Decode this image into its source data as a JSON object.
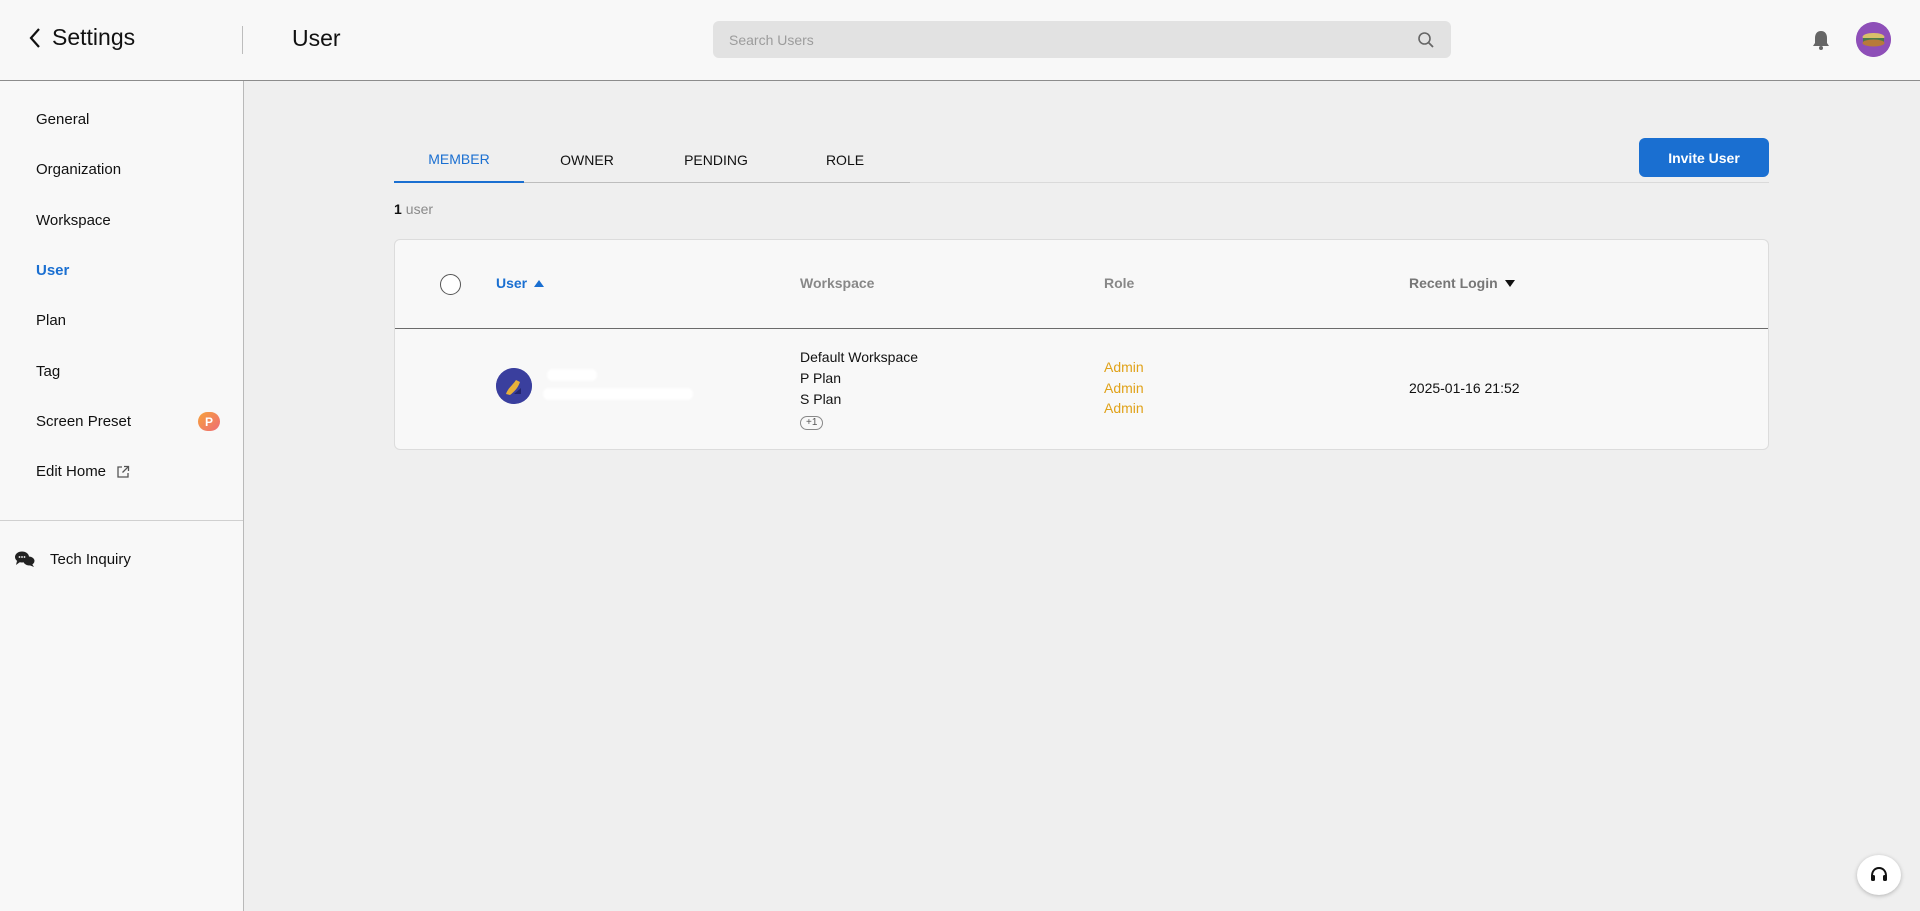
{
  "header": {
    "back_label": "Settings",
    "page_title": "User",
    "search_placeholder": "Search Users"
  },
  "sidebar": {
    "items": [
      {
        "label": "General"
      },
      {
        "label": "Organization"
      },
      {
        "label": "Workspace"
      },
      {
        "label": "User",
        "active": true
      },
      {
        "label": "Plan"
      },
      {
        "label": "Tag"
      },
      {
        "label": "Screen Preset",
        "badge": "P"
      },
      {
        "label": "Edit Home",
        "icon": "external-link-icon"
      }
    ],
    "tech_inquiry": "Tech Inquiry"
  },
  "tabs": [
    {
      "label": "MEMBER",
      "active": true
    },
    {
      "label": "OWNER"
    },
    {
      "label": "PENDING"
    },
    {
      "label": "ROLE"
    }
  ],
  "invite_label": "Invite User",
  "count": {
    "number": "1",
    "unit": "user"
  },
  "table": {
    "columns": {
      "user": "User",
      "workspace": "Workspace",
      "role": "Role",
      "recent_login": "Recent Login"
    },
    "rows": [
      {
        "workspaces": [
          "Default Workspace",
          "P Plan",
          "S Plan"
        ],
        "more": "+1",
        "roles": [
          "Admin",
          "Admin",
          "Admin"
        ],
        "recent_login": "2025-01-16 21:52"
      }
    ]
  },
  "colors": {
    "accent": "#1a6fd1",
    "role_text": "#e0a21a"
  }
}
